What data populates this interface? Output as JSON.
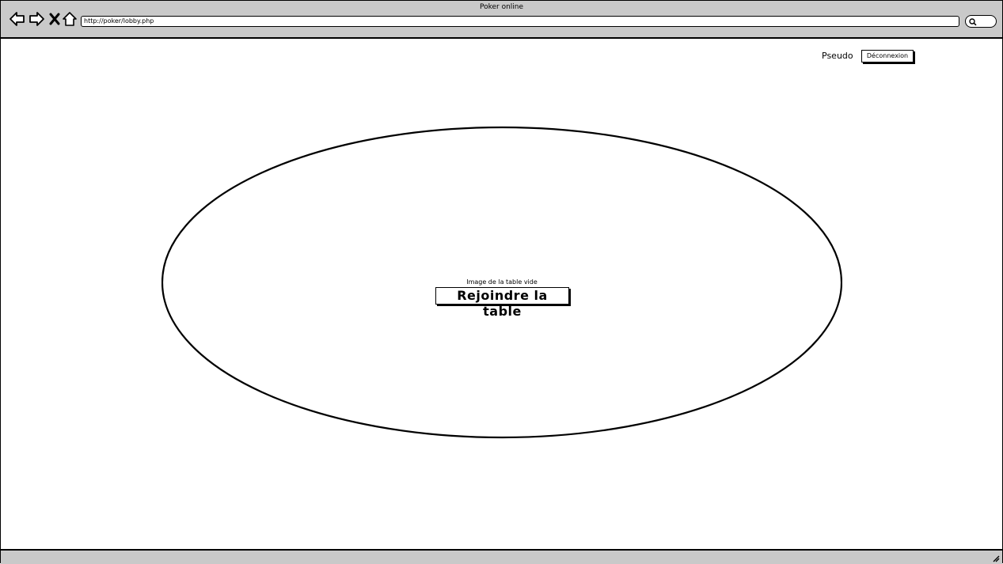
{
  "window": {
    "title": "Poker online",
    "url": "http://poker/lobby.php"
  },
  "nav": {
    "back_icon": "back-arrow-icon",
    "forward_icon": "forward-arrow-icon",
    "stop_icon": "close-icon",
    "home_icon": "home-icon",
    "search_icon": "search-icon"
  },
  "header": {
    "username": "Pseudo",
    "logout_label": "Déconnexion"
  },
  "table": {
    "caption": "Image de la table vide",
    "join_label": "Rejoindre la table"
  }
}
